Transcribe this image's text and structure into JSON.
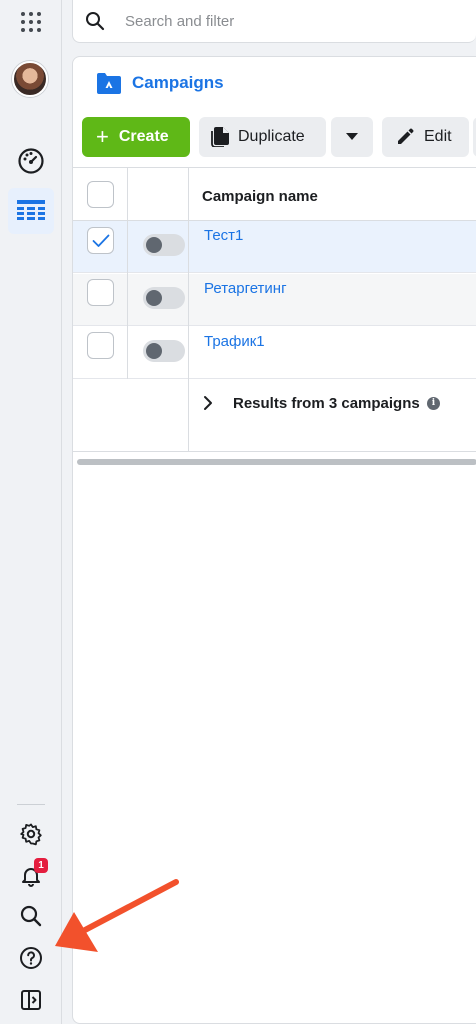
{
  "search": {
    "placeholder": "Search and filter"
  },
  "panel": {
    "title": "Campaigns"
  },
  "toolbar": {
    "create_label": "Create",
    "duplicate_label": "Duplicate",
    "edit_label": "Edit"
  },
  "table": {
    "column_header": "Campaign name",
    "rows": [
      {
        "name": "Тест1",
        "selected": true,
        "toggle_on": false
      },
      {
        "name": "Ретаргетинг",
        "selected": false,
        "toggle_on": false
      },
      {
        "name": "Трафик1",
        "selected": false,
        "toggle_on": false
      }
    ],
    "results_label": "Results from 3 campaigns",
    "info_icon": "i"
  },
  "rail": {
    "notifications_badge": "1",
    "icons": [
      "apps-grid-icon",
      "dashboard-gauge-icon",
      "campaigns-table-icon",
      "settings-gear-icon",
      "notifications-bell-icon",
      "search-icon",
      "help-icon",
      "collapse-panel-icon"
    ]
  },
  "colors": {
    "accent": "#1b74e4",
    "create": "#5fb817",
    "badge": "#e41e3f",
    "arrow": "#f2512c"
  }
}
